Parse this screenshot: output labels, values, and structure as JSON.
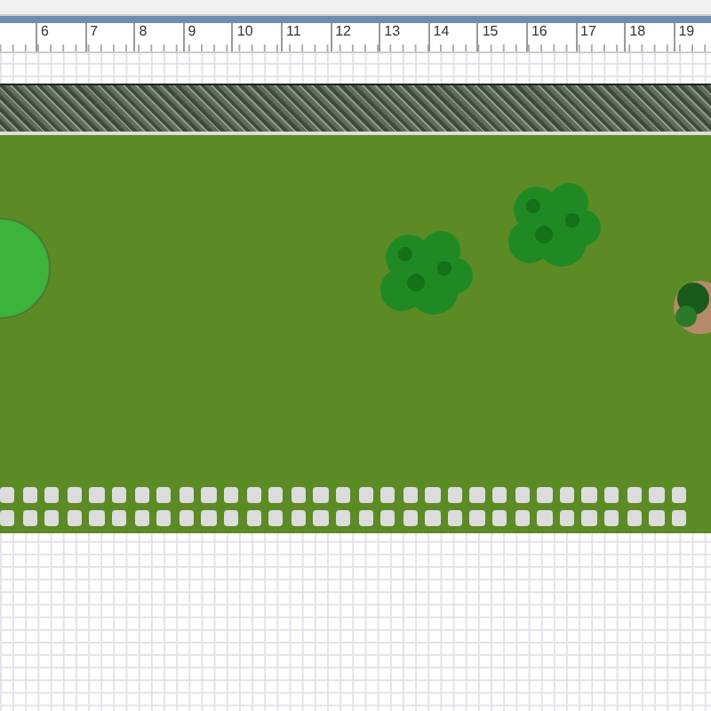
{
  "ruler": {
    "labels": [
      "6",
      "7",
      "8",
      "9",
      "10",
      "11",
      "12",
      "13",
      "14",
      "15",
      "16",
      "17",
      "18",
      "19"
    ]
  },
  "plan": {
    "plants": [
      {
        "kind": "tree"
      },
      {
        "kind": "shrub"
      },
      {
        "kind": "shrub"
      },
      {
        "kind": "pot"
      }
    ]
  }
}
